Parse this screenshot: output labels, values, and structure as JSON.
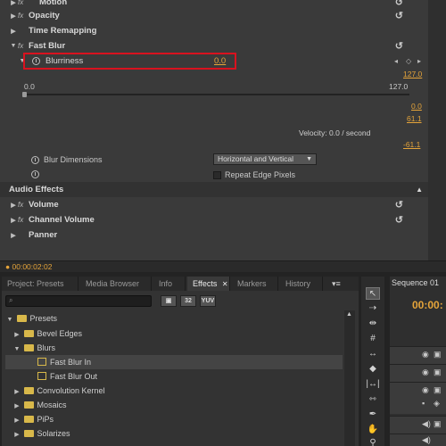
{
  "effect_controls": {
    "rows": [
      {
        "label": "Motion"
      },
      {
        "label": "Opacity"
      },
      {
        "label": "Time Remapping"
      },
      {
        "label": "Fast Blur"
      }
    ],
    "blurriness": {
      "label": "Blurriness",
      "value": "0.0"
    },
    "slider": {
      "min": "0.0",
      "max": "127.0"
    },
    "graph_values": [
      "127.0",
      "0.0",
      "61.1",
      "-61.1"
    ],
    "velocity": "Velocity: 0.0 / second",
    "blur_dimensions": {
      "label": "Blur Dimensions",
      "selected": "Horizontal and Vertical"
    },
    "repeat_edge": {
      "label": "Repeat Edge Pixels"
    },
    "audio_header": "Audio Effects",
    "audio_rows": [
      {
        "label": "Volume"
      },
      {
        "label": "Channel Volume"
      },
      {
        "label": "Panner"
      }
    ],
    "timecode": "00:00:02:02"
  },
  "tabs": [
    "Project: Presets",
    "Media Browser",
    "Info",
    "Effects",
    "Markers",
    "History"
  ],
  "toolbar_buttons": [
    "32",
    "YUV"
  ],
  "effects_tree": [
    {
      "label": "Presets"
    },
    {
      "label": "Bevel Edges"
    },
    {
      "label": "Blurs"
    },
    {
      "label": "Fast Blur In"
    },
    {
      "label": "Fast Blur Out"
    },
    {
      "label": "Convolution Kernel"
    },
    {
      "label": "Mosaics"
    },
    {
      "label": "PiPs"
    },
    {
      "label": "Solarizes"
    }
  ],
  "sequence": {
    "tab": "Sequence 01",
    "timecode": "00:00:"
  },
  "colors": {
    "accent_orange": "#e5a43a",
    "highlight_red": "#d9121f",
    "folder_yellow": "#d8b84a"
  }
}
